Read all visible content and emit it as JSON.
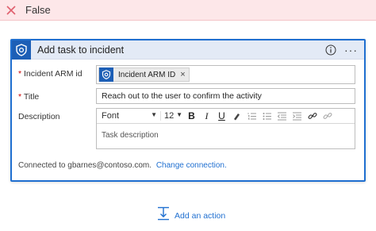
{
  "false_branch": {
    "label": "False"
  },
  "card": {
    "title": "Add task to incident",
    "fields": {
      "incident_arm_id": {
        "label": "Incident ARM id",
        "token": "Incident ARM ID"
      },
      "title": {
        "label": "Title",
        "value": "Reach out to the user to confirm the activity"
      },
      "description": {
        "label": "Description",
        "font": "Font",
        "font_size": "12",
        "placeholder": "Task description"
      }
    },
    "connection": {
      "text": "Connected to gbarnes@contoso.com.",
      "link": "Change connection."
    }
  },
  "add_action": {
    "label": "Add an action"
  },
  "colors": {
    "accent": "#1f6fd0",
    "false_bg": "#fde7e9",
    "false_x": "#e0606e",
    "header_bg": "#e3eaf6",
    "logo_bg": "#1d5fb6"
  },
  "icons": [
    "close-icon",
    "sentinel-logo-icon",
    "info-icon",
    "more-icon",
    "bold-icon",
    "italic-icon",
    "underline-icon",
    "highlighter-icon",
    "ordered-list-icon",
    "unordered-list-icon",
    "outdent-icon",
    "indent-icon",
    "link-icon",
    "unlink-icon",
    "add-action-icon"
  ]
}
